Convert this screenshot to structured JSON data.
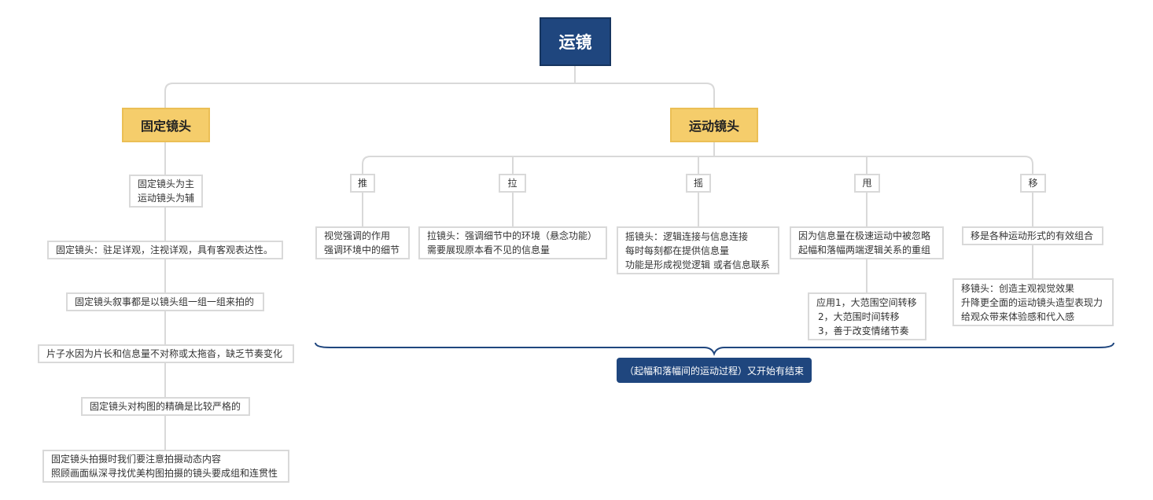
{
  "root": {
    "label": "运镜"
  },
  "fixed": {
    "label": "固定镜头",
    "children": [
      {
        "lines": [
          "固定镜头为主",
          "运动镜头为辅"
        ]
      },
      {
        "lines": [
          "固定镜头：驻足详观，注视详观，具有客观表达性。"
        ]
      },
      {
        "lines": [
          "固定镜头叙事都是以镜头组一组一组来拍的"
        ]
      },
      {
        "lines": [
          "片子水因为片长和信息量不对称或太拖沓，缺乏节奏变化"
        ]
      },
      {
        "lines": [
          "固定镜头对构图的精确是比较严格的"
        ]
      },
      {
        "lines": [
          "固定镜头拍摄时我们要注意拍摄动态内容",
          "照顾画面纵深寻找优美构图拍摄的镜头要成组和连贯性"
        ]
      }
    ]
  },
  "moving": {
    "label": "运动镜头",
    "branches": [
      {
        "label": "推",
        "desc": [
          "视觉强调的作用",
          "强调环境中的细节"
        ]
      },
      {
        "label": "拉",
        "desc": [
          "拉镜头：强调细节中的环境（悬念功能）",
          "需要展现原本看不见的信息量"
        ]
      },
      {
        "label": "摇",
        "desc": [
          "摇镜头：逻辑连接与信息连接",
          "每时每刻都在提供信息量",
          "功能是形成视觉逻辑 或者信息联系"
        ]
      },
      {
        "label": "甩",
        "desc": [
          "因为信息量在极速运动中被忽略",
          "起幅和落幅两端逻辑关系的重组"
        ],
        "sub": [
          "应用1，大范围空间转移",
          "2，大范围时间转移",
          "3，善于改变情绪节奏"
        ]
      },
      {
        "label": "移",
        "desc": [
          "移是各种运动形式的有效组合"
        ],
        "sub": [
          "移镜头：创造主观视觉效果",
          "升降更全面的运动镜头造型表现力",
          "给观众带来体验感和代入感"
        ]
      }
    ]
  },
  "summary": {
    "label": "（起幅和落幅间的运动过程）又开始有结束"
  },
  "colors": {
    "root_bg": "#1f467e",
    "main_bg": "#f5cd6b",
    "line": "#d9d9d9",
    "brace": "#1f467e"
  }
}
